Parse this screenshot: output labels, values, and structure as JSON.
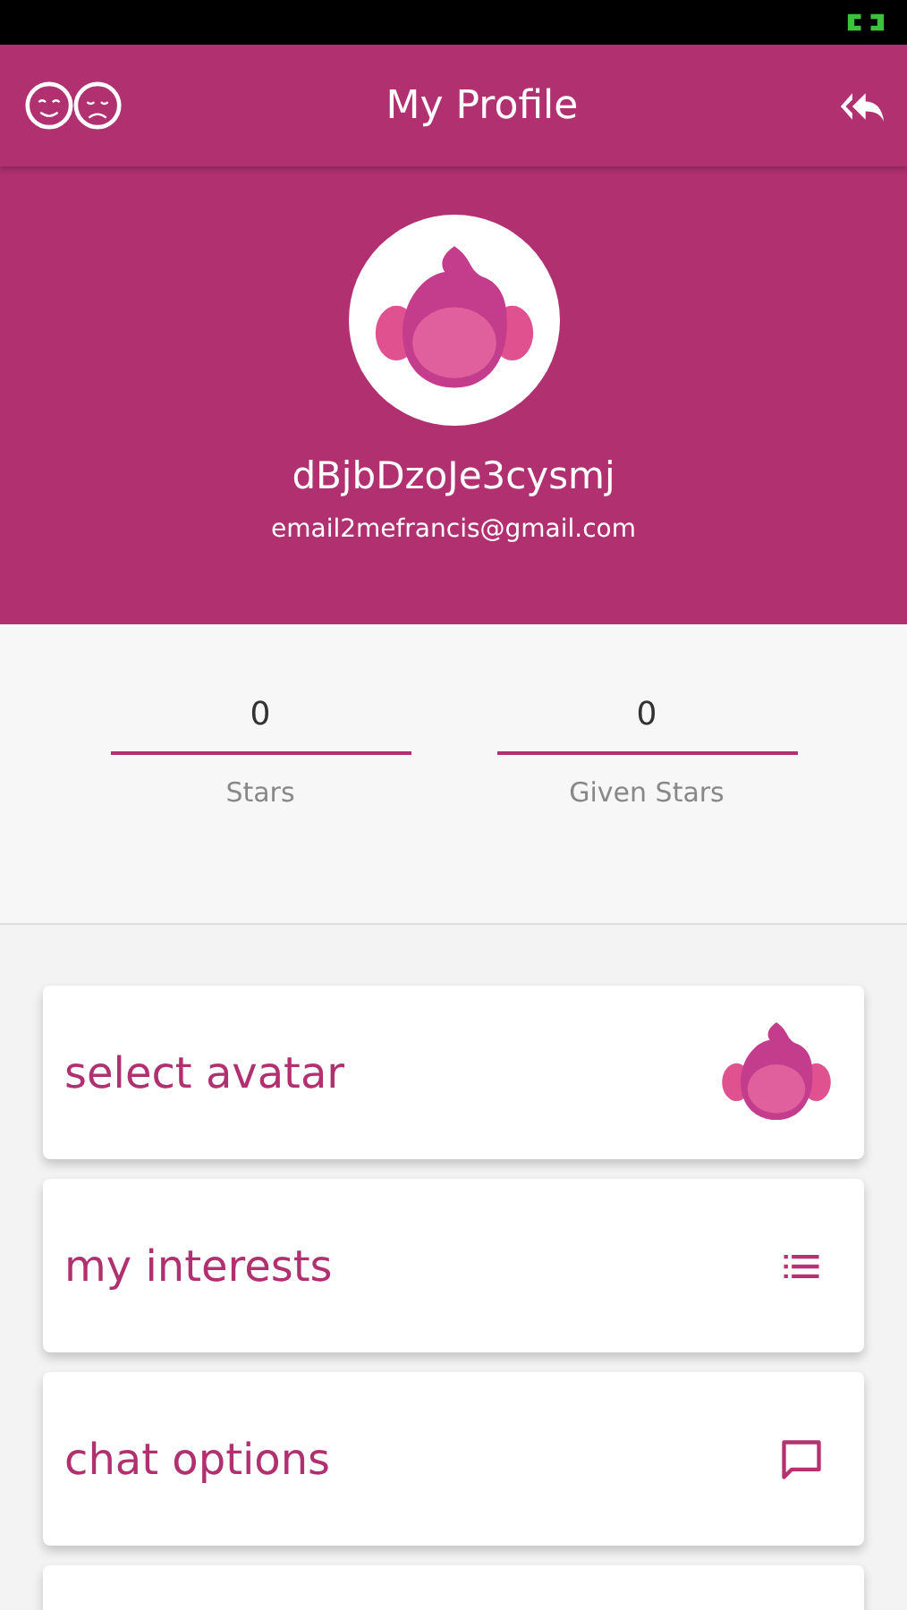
{
  "header": {
    "title": "My Profile"
  },
  "profile": {
    "username": "dBjbDzoJe3cysmj",
    "email": "email2mefrancis@gmail.com"
  },
  "stats": [
    {
      "value": "0",
      "label": "Stars"
    },
    {
      "value": "0",
      "label": "Given Stars"
    }
  ],
  "menu": [
    {
      "label": "select avatar",
      "kind": "avatar"
    },
    {
      "label": "my interests",
      "kind": "list"
    },
    {
      "label": "chat options",
      "kind": "chat"
    },
    {
      "kind": "blank"
    }
  ]
}
